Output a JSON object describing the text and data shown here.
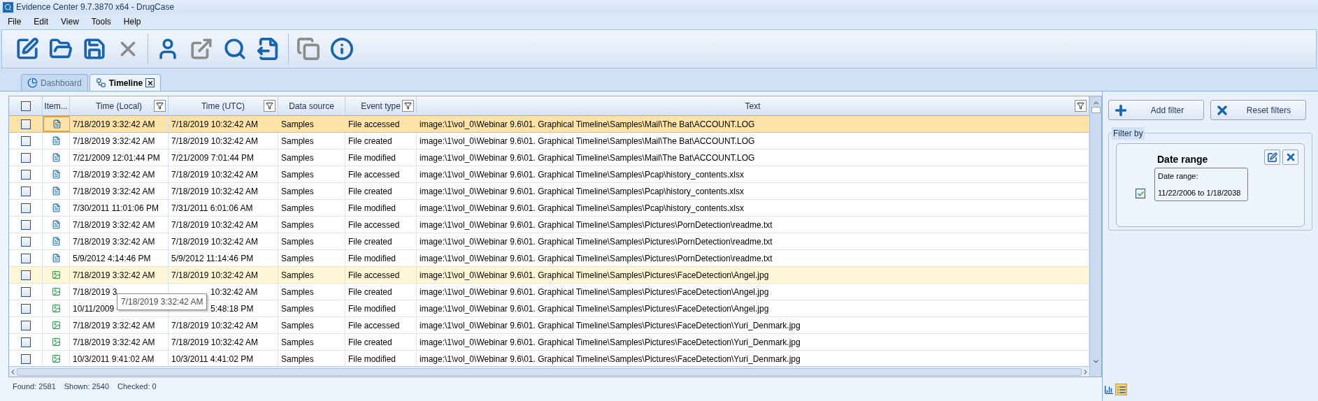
{
  "window": {
    "title": "Evidence Center 9.7.3870 x64 - DrugCase"
  },
  "menu": [
    "File",
    "Edit",
    "View",
    "Tools",
    "Help"
  ],
  "toolbar": [
    {
      "disabled": false
    },
    {
      "disabled": false
    },
    {
      "disabled": false
    },
    {
      "disabled": true
    },
    {
      "disabled": false
    },
    {
      "disabled": true
    },
    {
      "disabled": false
    },
    {
      "disabled": false
    },
    {
      "disabled": true
    },
    {
      "disabled": false
    }
  ],
  "tabs": [
    {
      "label": "Dashboard",
      "selected": false,
      "closable": false
    },
    {
      "label": "Timeline",
      "selected": true,
      "closable": true
    }
  ],
  "table": {
    "header_checked": false,
    "columns": [
      {
        "label": "Item...",
        "filter": false
      },
      {
        "label": "Time (Local)",
        "filter": true
      },
      {
        "label": "Time (UTC)",
        "filter": true
      },
      {
        "label": "Data source",
        "filter": false
      },
      {
        "label": "Event type",
        "filter": true
      },
      {
        "label": "Text",
        "filter": true
      }
    ],
    "rows": [
      {
        "kind": "document",
        "checked": false,
        "selected": true,
        "hovered": false,
        "time_local": "7/18/2019 3:32:42 AM",
        "time_utc": "7/18/2019 10:32:42 AM",
        "data_source": "Samples",
        "event_type": "File accessed",
        "text": "image:\\1\\vol_0\\Webinar 9.6\\01. Graphical Timeline\\Samples\\Mail\\The Bat\\ACCOUNT.LOG"
      },
      {
        "kind": "document",
        "checked": false,
        "selected": false,
        "hovered": false,
        "time_local": "7/18/2019 3:32:42 AM",
        "time_utc": "7/18/2019 10:32:42 AM",
        "data_source": "Samples",
        "event_type": "File created",
        "text": "image:\\1\\vol_0\\Webinar 9.6\\01. Graphical Timeline\\Samples\\Mail\\The Bat\\ACCOUNT.LOG"
      },
      {
        "kind": "document",
        "checked": false,
        "selected": false,
        "hovered": false,
        "time_local": "7/21/2009 12:01:44 PM",
        "time_utc": "7/21/2009 7:01:44 PM",
        "data_source": "Samples",
        "event_type": "File modified",
        "text": "image:\\1\\vol_0\\Webinar 9.6\\01. Graphical Timeline\\Samples\\Mail\\The Bat\\ACCOUNT.LOG"
      },
      {
        "kind": "document",
        "checked": false,
        "selected": false,
        "hovered": false,
        "time_local": "7/18/2019 3:32:42 AM",
        "time_utc": "7/18/2019 10:32:42 AM",
        "data_source": "Samples",
        "event_type": "File accessed",
        "text": "image:\\1\\vol_0\\Webinar 9.6\\01. Graphical Timeline\\Samples\\Pcap\\history_contents.xlsx"
      },
      {
        "kind": "document",
        "checked": false,
        "selected": false,
        "hovered": false,
        "time_local": "7/18/2019 3:32:42 AM",
        "time_utc": "7/18/2019 10:32:42 AM",
        "data_source": "Samples",
        "event_type": "File created",
        "text": "image:\\1\\vol_0\\Webinar 9.6\\01. Graphical Timeline\\Samples\\Pcap\\history_contents.xlsx"
      },
      {
        "kind": "document",
        "checked": false,
        "selected": false,
        "hovered": false,
        "time_local": "7/30/2011 11:01:06 PM",
        "time_utc": "7/31/2011 6:01:06 AM",
        "data_source": "Samples",
        "event_type": "File modified",
        "text": "image:\\1\\vol_0\\Webinar 9.6\\01. Graphical Timeline\\Samples\\Pcap\\history_contents.xlsx"
      },
      {
        "kind": "document",
        "checked": false,
        "selected": false,
        "hovered": false,
        "time_local": "7/18/2019 3:32:42 AM",
        "time_utc": "7/18/2019 10:32:42 AM",
        "data_source": "Samples",
        "event_type": "File accessed",
        "text": "image:\\1\\vol_0\\Webinar 9.6\\01. Graphical Timeline\\Samples\\Pictures\\PornDetection\\readme.txt"
      },
      {
        "kind": "document",
        "checked": false,
        "selected": false,
        "hovered": false,
        "time_local": "7/18/2019 3:32:42 AM",
        "time_utc": "7/18/2019 10:32:42 AM",
        "data_source": "Samples",
        "event_type": "File created",
        "text": "image:\\1\\vol_0\\Webinar 9.6\\01. Graphical Timeline\\Samples\\Pictures\\PornDetection\\readme.txt"
      },
      {
        "kind": "document",
        "checked": false,
        "selected": false,
        "hovered": false,
        "time_local": "5/9/2012 4:14:46 PM",
        "time_utc": "5/9/2012 11:14:46 PM",
        "data_source": "Samples",
        "event_type": "File modified",
        "text": "image:\\1\\vol_0\\Webinar 9.6\\01. Graphical Timeline\\Samples\\Pictures\\PornDetection\\readme.txt"
      },
      {
        "kind": "image",
        "checked": false,
        "selected": false,
        "hovered": true,
        "time_local": "7/18/2019 3:32:42 AM",
        "time_utc": "7/18/2019 10:32:42 AM",
        "data_source": "Samples",
        "event_type": "File accessed",
        "text": "image:\\1\\vol_0\\Webinar 9.6\\01. Graphical Timeline\\Samples\\Pictures\\FaceDetection\\Angel.jpg"
      },
      {
        "kind": "image",
        "checked": false,
        "selected": false,
        "hovered": false,
        "under_tooltip": true,
        "time_local": "7/18/2019 3",
        "time_utc": "10:32:42 AM",
        "data_source": "Samples",
        "event_type": "File created",
        "text": "image:\\1\\vol_0\\Webinar 9.6\\01. Graphical Timeline\\Samples\\Pictures\\FaceDetection\\Angel.jpg"
      },
      {
        "kind": "image",
        "checked": false,
        "selected": false,
        "hovered": false,
        "under_tooltip": true,
        "time_local": "10/11/2009",
        "time_utc": "5:48:18 PM",
        "data_source": "Samples",
        "event_type": "File modified",
        "text": "image:\\1\\vol_0\\Webinar 9.6\\01. Graphical Timeline\\Samples\\Pictures\\FaceDetection\\Angel.jpg"
      },
      {
        "kind": "image",
        "checked": false,
        "selected": false,
        "hovered": false,
        "time_local": "7/18/2019 3:32:42 AM",
        "time_utc": "7/18/2019 10:32:42 AM",
        "data_source": "Samples",
        "event_type": "File accessed",
        "text": "image:\\1\\vol_0\\Webinar 9.6\\01. Graphical Timeline\\Samples\\Pictures\\FaceDetection\\Yuri_Denmark.jpg"
      },
      {
        "kind": "image",
        "checked": false,
        "selected": false,
        "hovered": false,
        "time_local": "7/18/2019 3:32:42 AM",
        "time_utc": "7/18/2019 10:32:42 AM",
        "data_source": "Samples",
        "event_type": "File created",
        "text": "image:\\1\\vol_0\\Webinar 9.6\\01. Graphical Timeline\\Samples\\Pictures\\FaceDetection\\Yuri_Denmark.jpg"
      },
      {
        "kind": "image",
        "checked": false,
        "selected": false,
        "hovered": false,
        "time_local": "10/3/2011 9:41:02 AM",
        "time_utc": "10/3/2011 4:41:02 PM",
        "data_source": "Samples",
        "event_type": "File modified",
        "text": "image:\\1\\vol_0\\Webinar 9.6\\01. Graphical Timeline\\Samples\\Pictures\\FaceDetection\\Yuri_Denmark.jpg"
      }
    ],
    "tooltip": {
      "text": "7/18/2019 3:32:42 AM"
    }
  },
  "filter_panel": {
    "buttons": [
      {
        "label": "Add filter",
        "kind": "add"
      },
      {
        "label": "Reset filters",
        "kind": "reset"
      }
    ],
    "group_label": "Filter by",
    "filters": [
      {
        "title": "Date range",
        "enabled": true,
        "label": "Date range:",
        "value": "11/22/2006 to 1/18/2038"
      }
    ]
  },
  "status_bar": {
    "items": [
      "Found: 2581",
      "Shown: 2540",
      "Checked: 0"
    ],
    "views": [
      {
        "kind": "chart",
        "selected": false
      },
      {
        "kind": "list",
        "selected": true
      }
    ]
  }
}
